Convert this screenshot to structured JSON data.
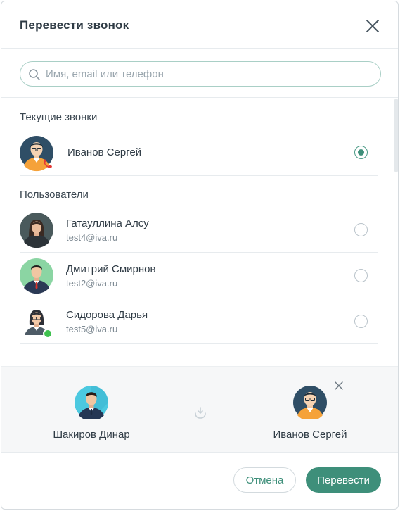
{
  "dialog": {
    "title": "Перевести звонок",
    "close_icon": "close-icon"
  },
  "search": {
    "placeholder": "Имя, email или телефон",
    "value": "",
    "icon": "search-icon"
  },
  "current_calls": {
    "title": "Текущие звонки",
    "items": [
      {
        "name": "Иванов Сергей",
        "selected": true,
        "badge_icon": "phone-icon"
      }
    ]
  },
  "users": {
    "title": "Пользователи",
    "items": [
      {
        "name": "Гатауллина Алсу",
        "email": "test4@iva.ru",
        "selected": false
      },
      {
        "name": "Дмитрий Смирнов",
        "email": "test2@iva.ru",
        "selected": false
      },
      {
        "name": "Сидорова Дарья",
        "email": "test5@iva.ru",
        "selected": false,
        "status": "online"
      }
    ]
  },
  "transfer": {
    "from_name": "Шакиров Динар",
    "to_name": "Иванов Сергей",
    "transfer_icon": "transfer-icon",
    "remove_icon": "close-icon"
  },
  "footer": {
    "cancel_label": "Отмена",
    "submit_label": "Перевести"
  },
  "colors": {
    "accent": "#3e8f7a",
    "online": "#3fc14f",
    "call_badge": "#e53935"
  }
}
